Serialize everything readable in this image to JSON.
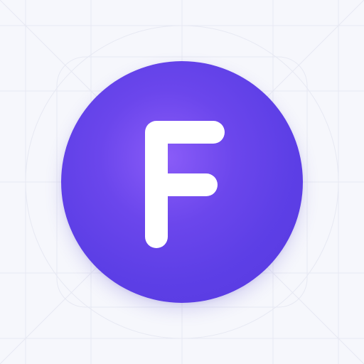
{
  "icon": {
    "name": "f-letter-icon",
    "background_color": "#f6f7fc",
    "grid_line_color": "#e6e8f2",
    "circle_color": "#5d3fe6",
    "circle_highlight_color": "#8a5cf8",
    "glyph_color": "#ffffff"
  }
}
